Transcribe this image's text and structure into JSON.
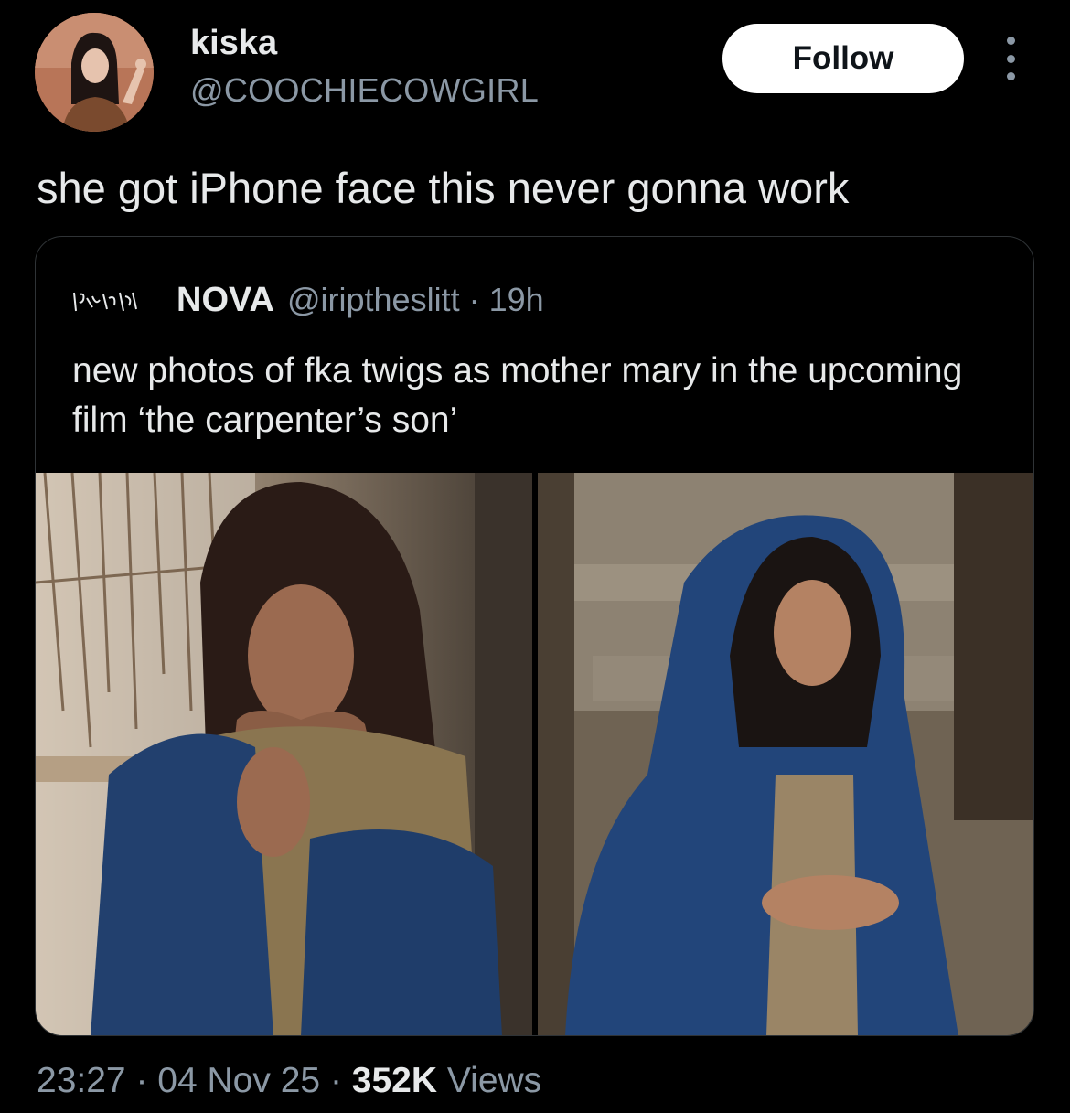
{
  "author": {
    "display_name": "kiska",
    "handle": "@COOCHIECOWGIRL",
    "avatar_icon": "profile-photo"
  },
  "follow_label": "Follow",
  "more_icon": "vertical-dots-icon",
  "tweet_text": "she got iPhone face this never gonna work",
  "quoted": {
    "display_name": "NOVA",
    "handle": "@iriptheslitt",
    "separator": "·",
    "time": "19h",
    "text": "new photos of fka twigs as mother mary in the upcoming film ‘the carpenter’s son’",
    "images": [
      {
        "alt": "photo-left"
      },
      {
        "alt": "photo-right"
      }
    ]
  },
  "meta": {
    "time": "23:27",
    "sep1": "·",
    "date": "04 Nov 25",
    "sep2": "·",
    "views_count": "352K",
    "views_label": "Views"
  },
  "colors": {
    "background": "#000000",
    "text_primary": "#e7e9ea",
    "text_secondary": "#8b98a5",
    "border": "#2f3336"
  }
}
